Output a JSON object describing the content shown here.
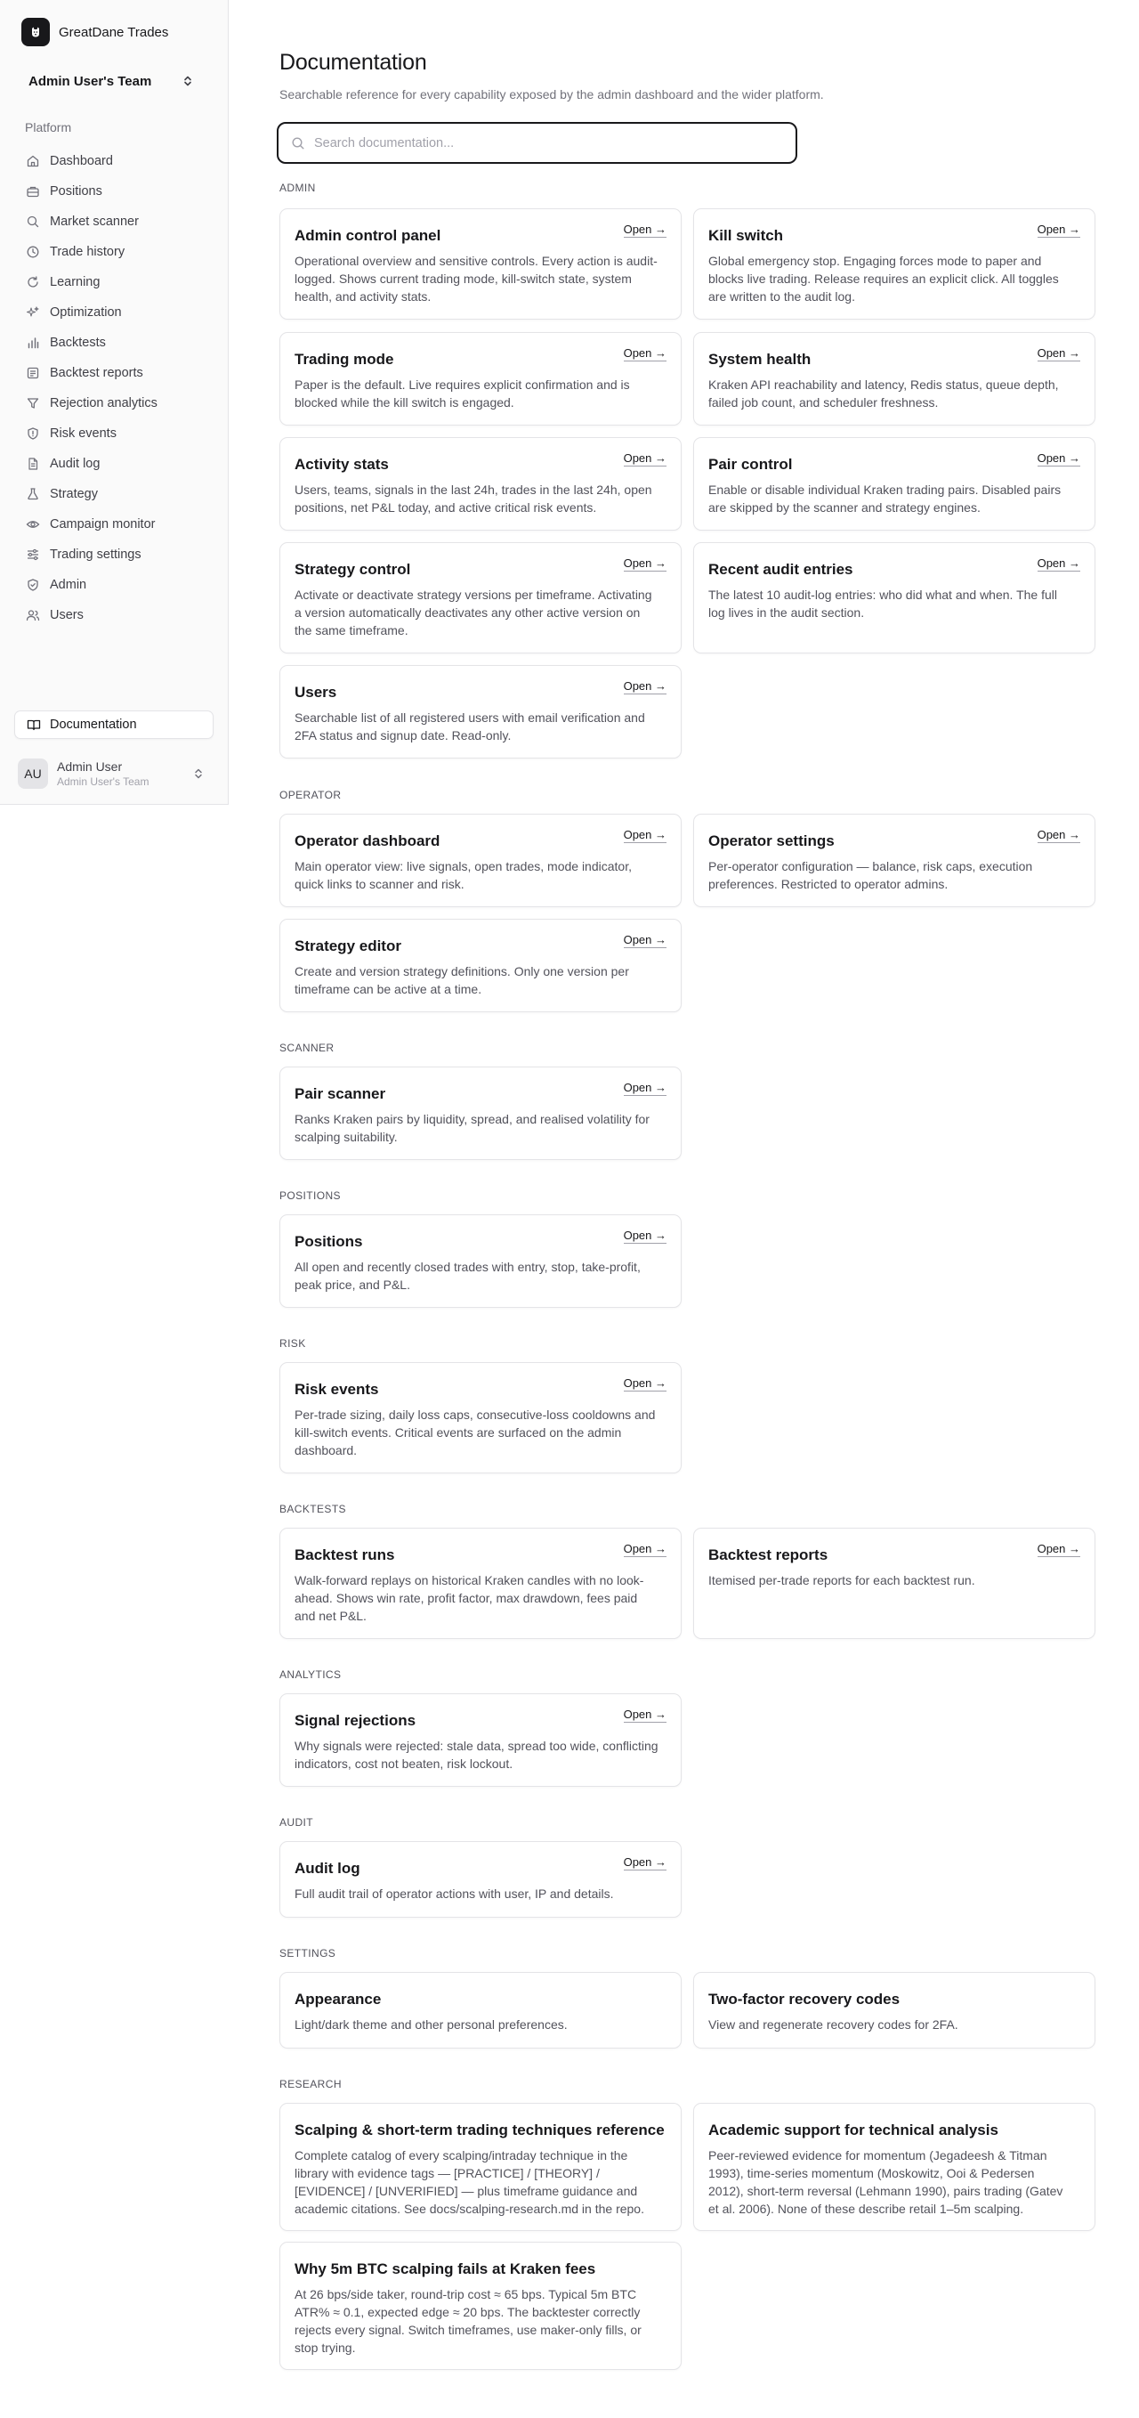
{
  "brand": {
    "name": "GreatDane Trades"
  },
  "team_switcher": {
    "label": "Admin User's Team"
  },
  "sidebar": {
    "group_label": "Platform",
    "items": [
      {
        "label": "Dashboard",
        "icon": "home-icon"
      },
      {
        "label": "Positions",
        "icon": "briefcase-icon"
      },
      {
        "label": "Market scanner",
        "icon": "search-icon"
      },
      {
        "label": "Trade history",
        "icon": "clock-icon"
      },
      {
        "label": "Learning",
        "icon": "refresh-icon"
      },
      {
        "label": "Optimization",
        "icon": "sparkles-icon"
      },
      {
        "label": "Backtests",
        "icon": "bar-chart-icon"
      },
      {
        "label": "Backtest reports",
        "icon": "report-icon"
      },
      {
        "label": "Rejection analytics",
        "icon": "filter-icon"
      },
      {
        "label": "Risk events",
        "icon": "shield-alert-icon"
      },
      {
        "label": "Audit log",
        "icon": "file-text-icon"
      },
      {
        "label": "Strategy",
        "icon": "flask-icon"
      },
      {
        "label": "Campaign monitor",
        "icon": "eye-icon"
      },
      {
        "label": "Trading settings",
        "icon": "sliders-icon"
      },
      {
        "label": "Admin",
        "icon": "shield-icon"
      },
      {
        "label": "Users",
        "icon": "users-icon"
      }
    ],
    "documentation": "Documentation",
    "user": {
      "initials": "AU",
      "name": "Admin User",
      "team": "Admin User's Team"
    }
  },
  "page": {
    "title": "Documentation",
    "subtitle": "Searchable reference for every capability exposed by the admin dashboard and the wider platform.",
    "search_placeholder": "Search documentation...",
    "open_label": "Open →"
  },
  "sections": [
    {
      "label": "ADMIN",
      "cards": [
        {
          "title": "Admin control panel",
          "desc": "Operational overview and sensitive controls. Every action is audit-logged. Shows current trading mode, kill-switch state, system health, and activity stats.",
          "open": true
        },
        {
          "title": "Kill switch",
          "desc": "Global emergency stop. Engaging forces mode to paper and blocks live trading. Release requires an explicit click. All toggles are written to the audit log.",
          "open": true
        },
        {
          "title": "Trading mode",
          "desc": "Paper is the default. Live requires explicit confirmation and is blocked while the kill switch is engaged.",
          "open": true
        },
        {
          "title": "System health",
          "desc": "Kraken API reachability and latency, Redis status, queue depth, failed job count, and scheduler freshness.",
          "open": true
        },
        {
          "title": "Activity stats",
          "desc": "Users, teams, signals in the last 24h, trades in the last 24h, open positions, net P&L today, and active critical risk events.",
          "open": true
        },
        {
          "title": "Pair control",
          "desc": "Enable or disable individual Kraken trading pairs. Disabled pairs are skipped by the scanner and strategy engines.",
          "open": true
        },
        {
          "title": "Strategy control",
          "desc": "Activate or deactivate strategy versions per timeframe. Activating a version automatically deactivates any other active version on the same timeframe.",
          "open": true
        },
        {
          "title": "Recent audit entries",
          "desc": "The latest 10 audit-log entries: who did what and when. The full log lives in the audit section.",
          "open": true
        },
        {
          "title": "Users",
          "desc": "Searchable list of all registered users with email verification and 2FA status and signup date. Read-only.",
          "open": true
        }
      ]
    },
    {
      "label": "OPERATOR",
      "cards": [
        {
          "title": "Operator dashboard",
          "desc": "Main operator view: live signals, open trades, mode indicator, quick links to scanner and risk.",
          "open": true
        },
        {
          "title": "Operator settings",
          "desc": "Per-operator configuration — balance, risk caps, execution preferences. Restricted to operator admins.",
          "open": true
        },
        {
          "title": "Strategy editor",
          "desc": "Create and version strategy definitions. Only one version per timeframe can be active at a time.",
          "open": true
        }
      ]
    },
    {
      "label": "SCANNER",
      "cards": [
        {
          "title": "Pair scanner",
          "desc": "Ranks Kraken pairs by liquidity, spread, and realised volatility for scalping suitability.",
          "open": true
        }
      ]
    },
    {
      "label": "POSITIONS",
      "cards": [
        {
          "title": "Positions",
          "desc": "All open and recently closed trades with entry, stop, take-profit, peak price, and P&L.",
          "open": true
        }
      ]
    },
    {
      "label": "RISK",
      "cards": [
        {
          "title": "Risk events",
          "desc": "Per-trade sizing, daily loss caps, consecutive-loss cooldowns and kill-switch events. Critical events are surfaced on the admin dashboard.",
          "open": true
        }
      ]
    },
    {
      "label": "BACKTESTS",
      "cards": [
        {
          "title": "Backtest runs",
          "desc": "Walk-forward replays on historical Kraken candles with no look-ahead. Shows win rate, profit factor, max drawdown, fees paid and net P&L.",
          "open": true
        },
        {
          "title": "Backtest reports",
          "desc": "Itemised per-trade reports for each backtest run.",
          "open": true
        }
      ]
    },
    {
      "label": "ANALYTICS",
      "cards": [
        {
          "title": "Signal rejections",
          "desc": "Why signals were rejected: stale data, spread too wide, conflicting indicators, cost not beaten, risk lockout.",
          "open": true
        }
      ]
    },
    {
      "label": "AUDIT",
      "cards": [
        {
          "title": "Audit log",
          "desc": "Full audit trail of operator actions with user, IP and details.",
          "open": true
        }
      ]
    },
    {
      "label": "SETTINGS",
      "cards": [
        {
          "title": "Appearance",
          "desc": "Light/dark theme and other personal preferences.",
          "open": false
        },
        {
          "title": "Two-factor recovery codes",
          "desc": "View and regenerate recovery codes for 2FA.",
          "open": false
        }
      ]
    },
    {
      "label": "RESEARCH",
      "cards": [
        {
          "title": "Scalping & short-term trading techniques reference",
          "desc": "Complete catalog of every scalping/intraday technique in the library with evidence tags — [PRACTICE] / [THEORY] / [EVIDENCE] / [UNVERIFIED] — plus timeframe guidance and academic citations. See docs/scalping-research.md in the repo.",
          "open": false
        },
        {
          "title": "Academic support for technical analysis",
          "desc": "Peer-reviewed evidence for momentum (Jegadeesh & Titman 1993), time-series momentum (Moskowitz, Ooi & Pedersen 2012), short-term reversal (Lehmann 1990), pairs trading (Gatev et al. 2006). None of these describe retail 1–5m scalping.",
          "open": false
        },
        {
          "title": "Why 5m BTC scalping fails at Kraken fees",
          "desc": "At 26 bps/side taker, round-trip cost ≈ 65 bps. Typical 5m BTC ATR% ≈ 0.1, expected edge ≈ 20 bps. The backtester correctly rejects every signal. Switch timeframes, use maker-only fills, or stop trying.",
          "open": false
        }
      ]
    }
  ]
}
